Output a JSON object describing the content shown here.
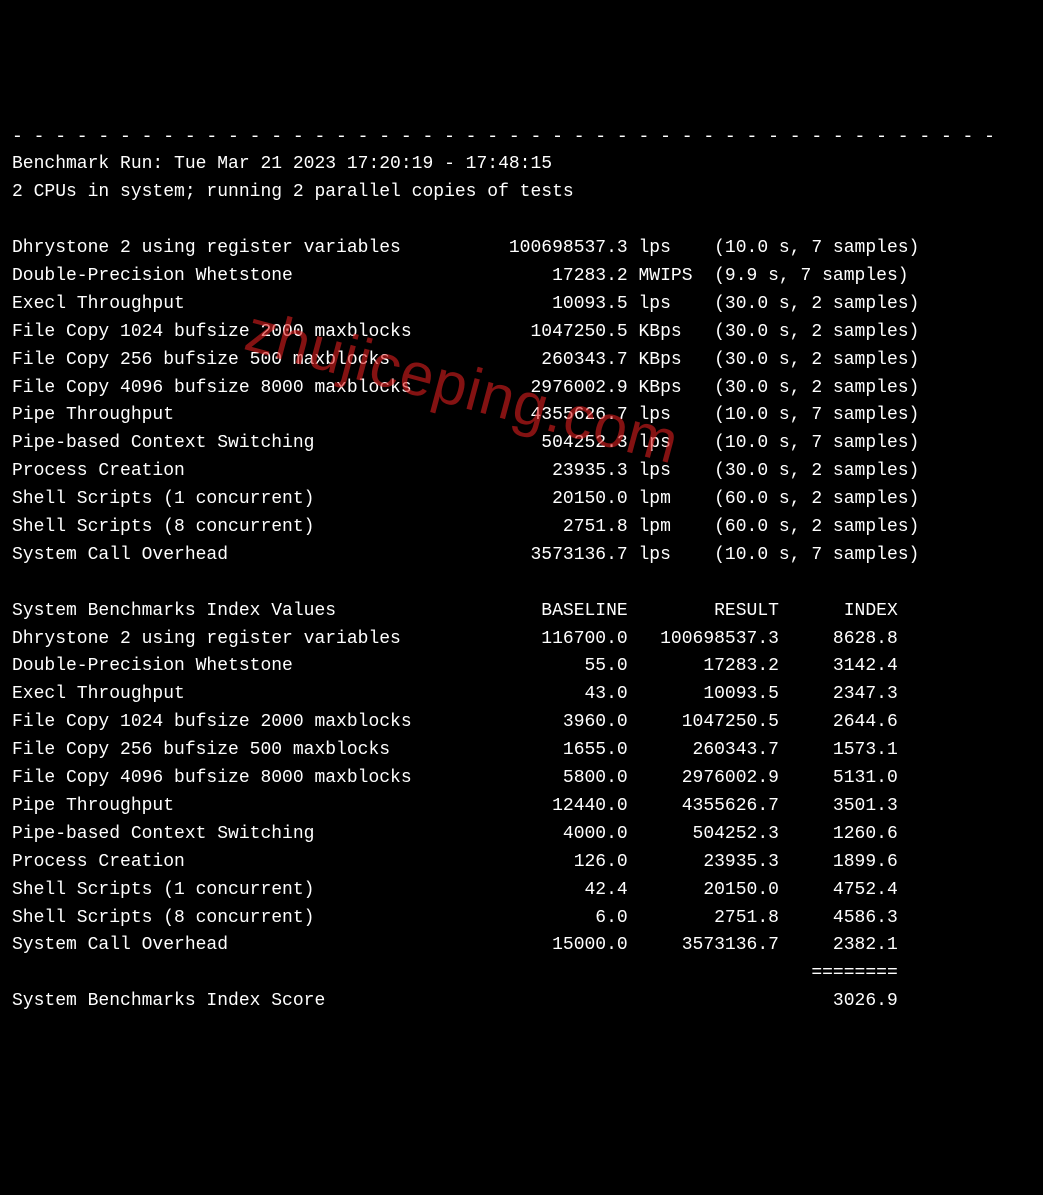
{
  "divider": "- - - - - - - - - - - - - - - - - - - - - - - - - - - - - - - - - - - - - - - - - - - - - -",
  "header": {
    "run_line": "Benchmark Run: Tue Mar 21 2023 17:20:19 - 17:48:15",
    "cpu_line": "2 CPUs in system; running 2 parallel copies of tests"
  },
  "tests": [
    {
      "name": "Dhrystone 2 using register variables",
      "value": "100698537.3",
      "unit": "lps",
      "detail": "(10.0 s, 7 samples)"
    },
    {
      "name": "Double-Precision Whetstone",
      "value": "17283.2",
      "unit": "MWIPS",
      "detail": "(9.9 s, 7 samples)"
    },
    {
      "name": "Execl Throughput",
      "value": "10093.5",
      "unit": "lps",
      "detail": "(30.0 s, 2 samples)"
    },
    {
      "name": "File Copy 1024 bufsize 2000 maxblocks",
      "value": "1047250.5",
      "unit": "KBps",
      "detail": "(30.0 s, 2 samples)"
    },
    {
      "name": "File Copy 256 bufsize 500 maxblocks",
      "value": "260343.7",
      "unit": "KBps",
      "detail": "(30.0 s, 2 samples)"
    },
    {
      "name": "File Copy 4096 bufsize 8000 maxblocks",
      "value": "2976002.9",
      "unit": "KBps",
      "detail": "(30.0 s, 2 samples)"
    },
    {
      "name": "Pipe Throughput",
      "value": "4355626.7",
      "unit": "lps",
      "detail": "(10.0 s, 7 samples)"
    },
    {
      "name": "Pipe-based Context Switching",
      "value": "504252.3",
      "unit": "lps",
      "detail": "(10.0 s, 7 samples)"
    },
    {
      "name": "Process Creation",
      "value": "23935.3",
      "unit": "lps",
      "detail": "(30.0 s, 2 samples)"
    },
    {
      "name": "Shell Scripts (1 concurrent)",
      "value": "20150.0",
      "unit": "lpm",
      "detail": "(60.0 s, 2 samples)"
    },
    {
      "name": "Shell Scripts (8 concurrent)",
      "value": "2751.8",
      "unit": "lpm",
      "detail": "(60.0 s, 2 samples)"
    },
    {
      "name": "System Call Overhead",
      "value": "3573136.7",
      "unit": "lps",
      "detail": "(10.0 s, 7 samples)"
    }
  ],
  "index_header": {
    "title": "System Benchmarks Index Values",
    "col1": "BASELINE",
    "col2": "RESULT",
    "col3": "INDEX"
  },
  "index": [
    {
      "name": "Dhrystone 2 using register variables",
      "baseline": "116700.0",
      "result": "100698537.3",
      "index": "8628.8"
    },
    {
      "name": "Double-Precision Whetstone",
      "baseline": "55.0",
      "result": "17283.2",
      "index": "3142.4"
    },
    {
      "name": "Execl Throughput",
      "baseline": "43.0",
      "result": "10093.5",
      "index": "2347.3"
    },
    {
      "name": "File Copy 1024 bufsize 2000 maxblocks",
      "baseline": "3960.0",
      "result": "1047250.5",
      "index": "2644.6"
    },
    {
      "name": "File Copy 256 bufsize 500 maxblocks",
      "baseline": "1655.0",
      "result": "260343.7",
      "index": "1573.1"
    },
    {
      "name": "File Copy 4096 bufsize 8000 maxblocks",
      "baseline": "5800.0",
      "result": "2976002.9",
      "index": "5131.0"
    },
    {
      "name": "Pipe Throughput",
      "baseline": "12440.0",
      "result": "4355626.7",
      "index": "3501.3"
    },
    {
      "name": "Pipe-based Context Switching",
      "baseline": "4000.0",
      "result": "504252.3",
      "index": "1260.6"
    },
    {
      "name": "Process Creation",
      "baseline": "126.0",
      "result": "23935.3",
      "index": "1899.6"
    },
    {
      "name": "Shell Scripts (1 concurrent)",
      "baseline": "42.4",
      "result": "20150.0",
      "index": "4752.4"
    },
    {
      "name": "Shell Scripts (8 concurrent)",
      "baseline": "6.0",
      "result": "2751.8",
      "index": "4586.3"
    },
    {
      "name": "System Call Overhead",
      "baseline": "15000.0",
      "result": "3573136.7",
      "index": "2382.1"
    }
  ],
  "score": {
    "label": "System Benchmarks Index Score",
    "value": "3026.9"
  },
  "score_divider": "========",
  "watermark": "zhujiceping.com"
}
